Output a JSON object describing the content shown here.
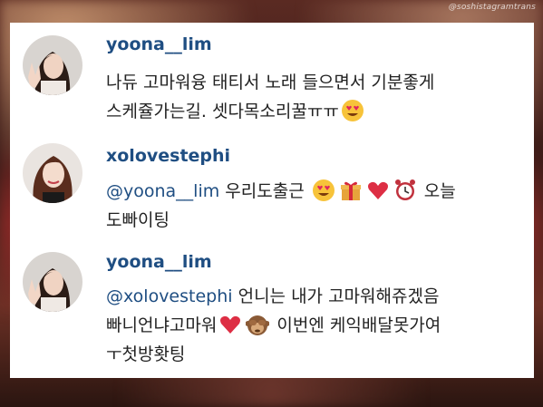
{
  "watermark": "@soshistagramtrans",
  "colors": {
    "username": "#1f4e82",
    "text": "#222222",
    "card": "#ffffff"
  },
  "comments": [
    {
      "username": "yoona__lim",
      "avatar": "avatar-yoona",
      "line1": "나듀 고마워융 태티서 노래 들으면서 기분좋게",
      "line2": "스케쥴가는길. 셋다목소리꿀ㅠㅠ",
      "line2_emoji": "heart-eyes-emoji"
    },
    {
      "username": "xolovestephi",
      "avatar": "avatar-tiffany",
      "mention": "@yoona__lim",
      "line1_text": " 우리도출근 ",
      "line1_emojis": [
        "heart-eyes-emoji",
        "gift-emoji",
        "red-heart-emoji",
        "alarm-clock-emoji"
      ],
      "line1_end": " 오늘",
      "line2": "도빠이팅"
    },
    {
      "username": "yoona__lim",
      "avatar": "avatar-yoona",
      "mention": "@xolovestephi",
      "line1_text": " 언니는 내가 고마워해쥬겠음",
      "line2_start": "빠니언냐고마워",
      "line2_emojis": [
        "red-heart-emoji",
        "see-no-evil-monkey-emoji"
      ],
      "line2_end": " 이번엔 케익배달못가여",
      "line3": "ㅜ첫방홧팅"
    }
  ]
}
